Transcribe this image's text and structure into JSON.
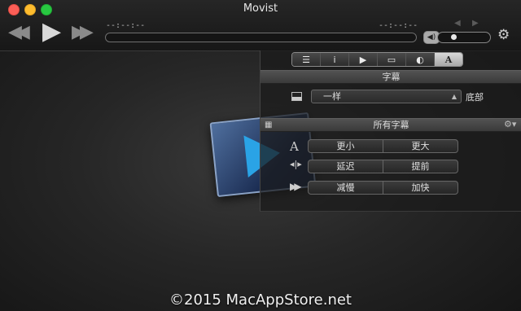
{
  "window": {
    "title": "Movist"
  },
  "playback": {
    "rewind_icon": "rewind-icon",
    "play_icon": "play-icon",
    "ffwd_icon": "fast-forward-icon",
    "time_elapsed": "--:--:--",
    "time_remaining": "--:--:--",
    "progress": 0,
    "volume": 0.25
  },
  "panel": {
    "tabs": [
      {
        "icon": "list-icon",
        "label": "☰"
      },
      {
        "icon": "info-icon",
        "label": "i"
      },
      {
        "icon": "play-icon",
        "label": "▶"
      },
      {
        "icon": "display-icon",
        "label": "▭"
      },
      {
        "icon": "audio-icon",
        "label": "◐"
      },
      {
        "icon": "text-icon",
        "label": "A",
        "active": true
      }
    ],
    "subtitle_header": "字幕",
    "subtitle_select": "一样",
    "position_label": "底部",
    "all_subtitles_header": "所有字幕",
    "size_icon": "A",
    "rows": [
      {
        "left": "更小",
        "right": "更大"
      },
      {
        "left": "延迟",
        "right": "提前"
      },
      {
        "left": "减慢",
        "right": "加快"
      }
    ]
  },
  "watermark": "©2015 MacAppStore.net",
  "colors": {
    "accent": "#2aa3e6",
    "close": "#fc5f57",
    "minimize": "#fdbc2e",
    "zoom": "#28c841"
  }
}
